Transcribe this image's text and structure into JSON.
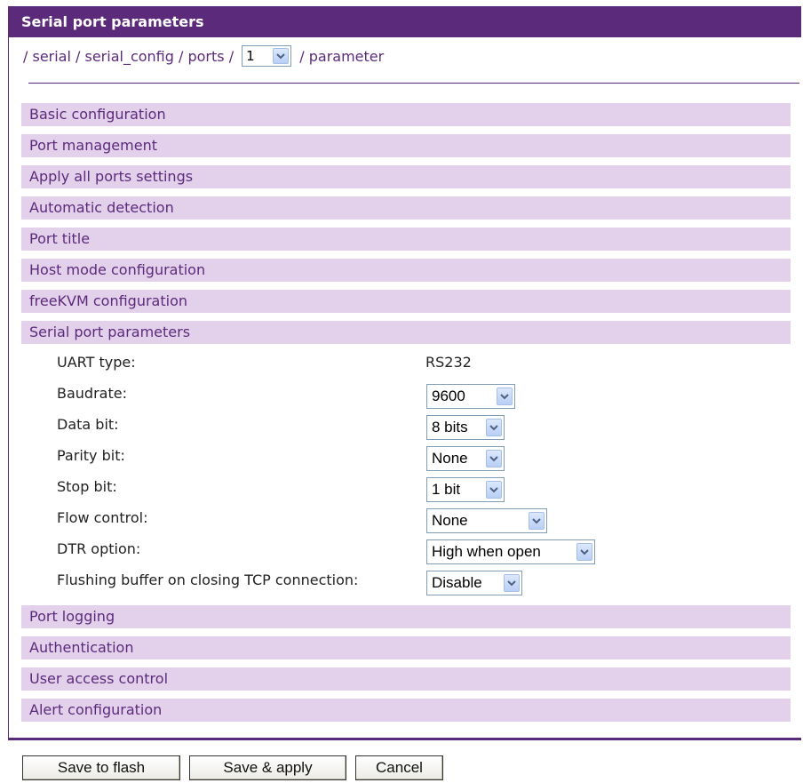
{
  "panel": {
    "title": "Serial port parameters"
  },
  "breadcrumb": {
    "part1": "/ serial / serial_config / ports /",
    "port_selected": "1",
    "part2": "/ parameter"
  },
  "sections_before": [
    {
      "label": "Basic configuration"
    },
    {
      "label": "Port management"
    },
    {
      "label": "Apply all ports settings"
    },
    {
      "label": "Automatic detection"
    },
    {
      "label": "Port title"
    },
    {
      "label": "Host mode configuration"
    },
    {
      "label": "freeKVM configuration"
    },
    {
      "label": "Serial port parameters"
    }
  ],
  "params": {
    "uart_type": {
      "label": "UART type:",
      "value": "RS232"
    },
    "baudrate": {
      "label": "Baudrate:",
      "value": "9600"
    },
    "data_bit": {
      "label": "Data bit:",
      "value": "8 bits"
    },
    "parity_bit": {
      "label": "Parity bit:",
      "value": "None"
    },
    "stop_bit": {
      "label": "Stop bit:",
      "value": "1 bit"
    },
    "flow_control": {
      "label": "Flow control:",
      "value": "None"
    },
    "dtr_option": {
      "label": "DTR option:",
      "value": "High when open"
    },
    "flushing_buffer": {
      "label": "Flushing buffer on closing TCP connection:",
      "value": "Disable"
    }
  },
  "sections_after": [
    {
      "label": "Port logging"
    },
    {
      "label": "Authentication"
    },
    {
      "label": "User access control"
    },
    {
      "label": "Alert configuration"
    }
  ],
  "buttons": {
    "save_flash": "Save to flash",
    "save_apply": "Save & apply",
    "cancel": "Cancel"
  },
  "colors": {
    "header_bg": "#5c2a7a",
    "section_bg": "#e3d1ec",
    "link_text": "#5c2a7a"
  },
  "icons": {
    "dropdown": "chevron-down-icon"
  }
}
